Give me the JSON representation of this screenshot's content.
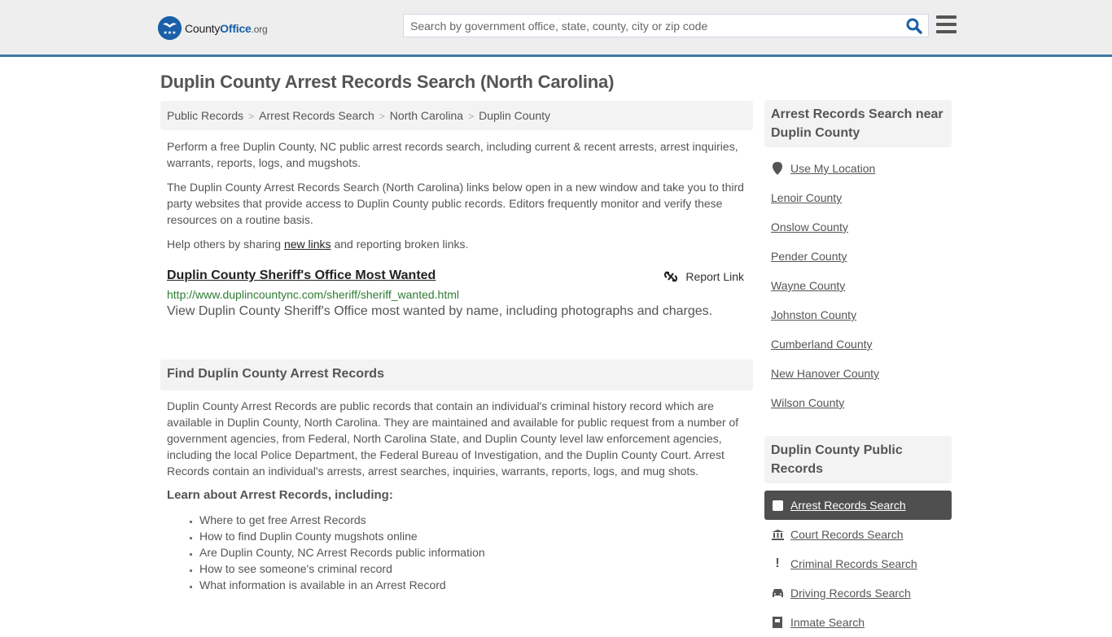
{
  "header": {
    "logo": {
      "part1": "County",
      "part2": "Office",
      "part3": ".org"
    },
    "search_placeholder": "Search by government office, state, county, city or zip code",
    "colors": {
      "brand": "#1a5fa8",
      "header_bg": "#eeeeee",
      "header_border": "#3d79a8"
    }
  },
  "page": {
    "title": "Duplin County Arrest Records Search (North Carolina)",
    "breadcrumb": [
      "Public Records",
      "Arrest Records Search",
      "North Carolina",
      "Duplin County"
    ],
    "intro": [
      "Perform a free Duplin County, NC public arrest records search, including current & recent arrests, arrest inquiries, warrants, reports, logs, and mugshots.",
      "The Duplin County Arrest Records Search (North Carolina) links below open in a new window and take you to third party websites that provide access to Duplin County public records. Editors frequently monitor and verify these resources on a routine basis."
    ],
    "share": {
      "before": "Help others by sharing ",
      "link": "new links",
      "after": " and reporting broken links."
    },
    "link_item": {
      "title": "Duplin County Sheriff's Office Most Wanted",
      "url": "http://www.duplincountync.com/sheriff/sheriff_wanted.html",
      "description": "View Duplin County Sheriff's Office most wanted by name, including photographs and charges.",
      "report_label": "Report Link"
    },
    "find_section": {
      "heading": "Find Duplin County Arrest Records",
      "body": "Duplin County Arrest Records are public records that contain an individual's criminal history record which are available in Duplin County, North Carolina. They are maintained and available for public request from a number of government agencies, from Federal, North Carolina State, and Duplin County level law enforcement agencies, including the local Police Department, the Federal Bureau of Investigation, and the Duplin County Court. Arrest Records contain an individual's arrests, arrest searches, inquiries, warrants, reports, logs, and mug shots.",
      "learn_heading": "Learn about Arrest Records, including:",
      "learn_items": [
        "Where to get free Arrest Records",
        "How to find Duplin County mugshots online",
        "Are Duplin County, NC Arrest Records public information",
        "How to see someone's criminal record",
        "What information is available in an Arrest Record"
      ]
    }
  },
  "sidebar": {
    "nearby": {
      "heading": "Arrest Records Search near Duplin County",
      "use_location": "Use My Location",
      "items": [
        "Lenoir County",
        "Onslow County",
        "Pender County",
        "Wayne County",
        "Johnston County",
        "Cumberland County",
        "New Hanover County",
        "Wilson County"
      ]
    },
    "public_records": {
      "heading": "Duplin County Public Records",
      "items": [
        {
          "label": "Arrest Records Search",
          "icon": "square-icon",
          "active": true
        },
        {
          "label": "Court Records Search",
          "icon": "courthouse-icon",
          "active": false
        },
        {
          "label": "Criminal Records Search",
          "icon": "exclamation-icon",
          "active": false
        },
        {
          "label": "Driving Records Search",
          "icon": "car-icon",
          "active": false
        },
        {
          "label": "Inmate Search",
          "icon": "inmate-icon",
          "active": false
        }
      ]
    }
  }
}
